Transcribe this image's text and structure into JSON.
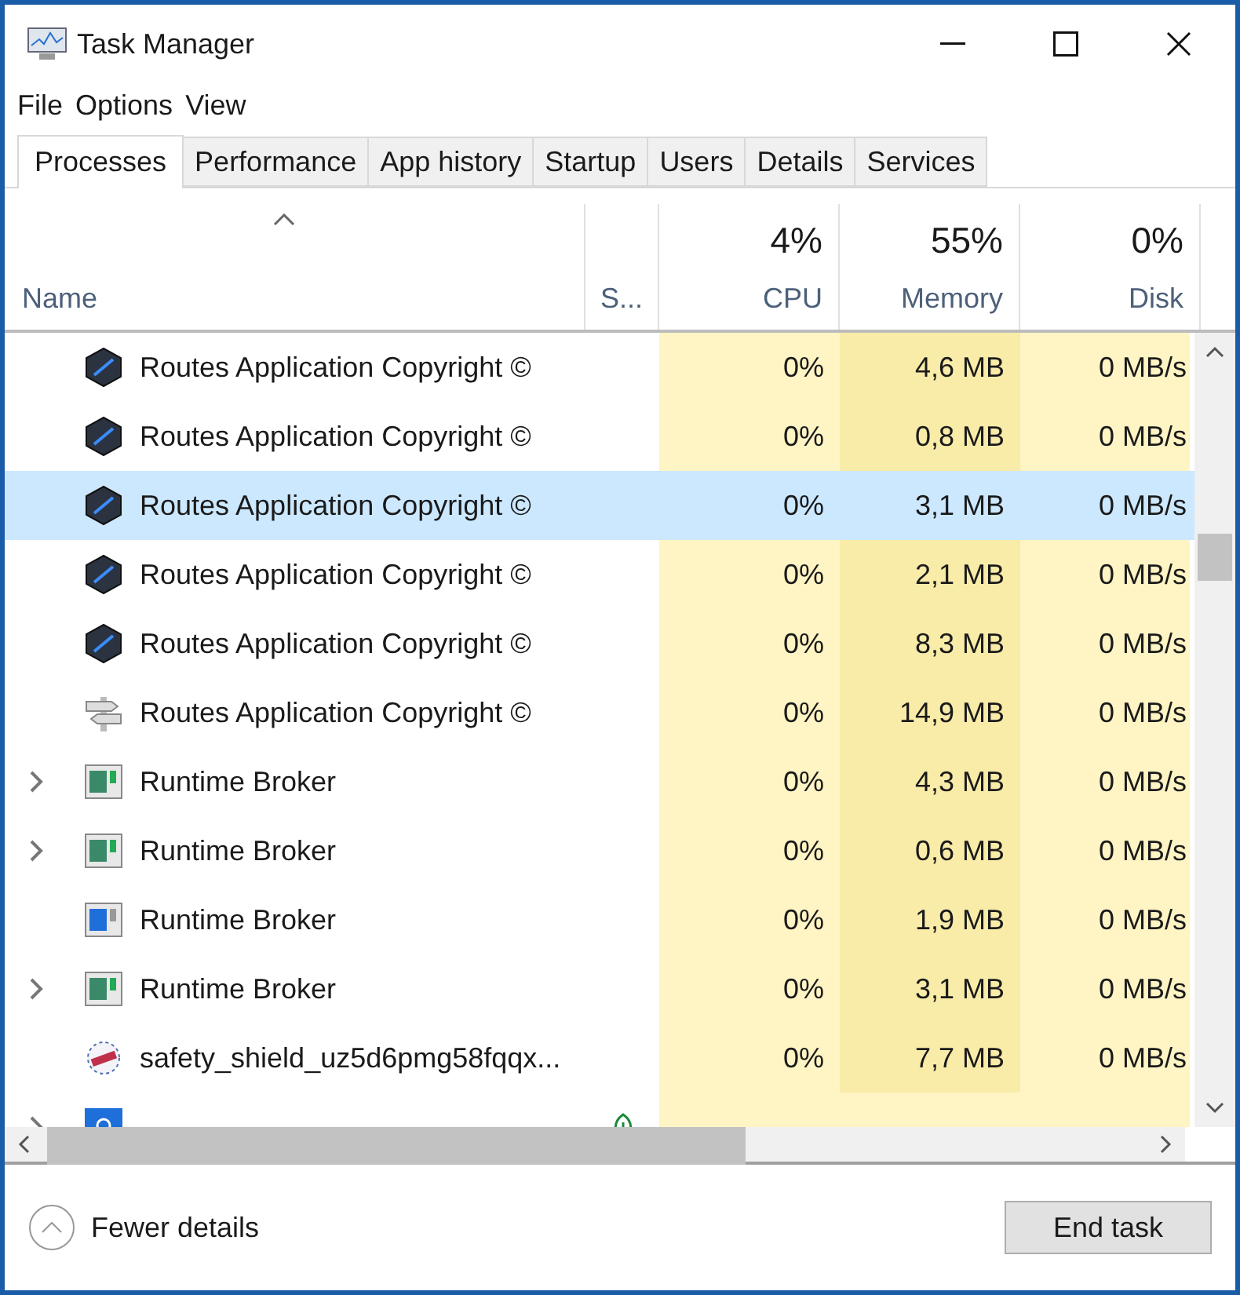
{
  "window": {
    "title": "Task Manager"
  },
  "menu": [
    "File",
    "Options",
    "View"
  ],
  "tabs": [
    {
      "label": "Processes",
      "selected": true
    },
    {
      "label": "Performance",
      "selected": false
    },
    {
      "label": "App history",
      "selected": false
    },
    {
      "label": "Startup",
      "selected": false
    },
    {
      "label": "Users",
      "selected": false
    },
    {
      "label": "Details",
      "selected": false
    },
    {
      "label": "Services",
      "selected": false
    }
  ],
  "table": {
    "columns": [
      {
        "label": "Name"
      },
      {
        "label": "S..."
      },
      {
        "percent": "4%",
        "label": "CPU"
      },
      {
        "percent": "55%",
        "label": "Memory"
      },
      {
        "percent": "0%",
        "label": "Disk"
      }
    ],
    "rows": [
      {
        "kind": "routes",
        "expandable": false,
        "selected": false,
        "suspended": false,
        "name": "Routes Application Copyright ©",
        "cpu": "0%",
        "memory": "4,6 MB",
        "disk": "0 MB/s"
      },
      {
        "kind": "routes",
        "expandable": false,
        "selected": false,
        "suspended": false,
        "name": "Routes Application Copyright ©",
        "cpu": "0%",
        "memory": "0,8 MB",
        "disk": "0 MB/s"
      },
      {
        "kind": "routes",
        "expandable": false,
        "selected": true,
        "suspended": false,
        "name": "Routes Application Copyright ©",
        "cpu": "0%",
        "memory": "3,1 MB",
        "disk": "0 MB/s"
      },
      {
        "kind": "routes",
        "expandable": false,
        "selected": false,
        "suspended": false,
        "name": "Routes Application Copyright ©",
        "cpu": "0%",
        "memory": "2,1 MB",
        "disk": "0 MB/s"
      },
      {
        "kind": "routes",
        "expandable": false,
        "selected": false,
        "suspended": false,
        "name": "Routes Application Copyright ©",
        "cpu": "0%",
        "memory": "8,3 MB",
        "disk": "0 MB/s"
      },
      {
        "kind": "signpost",
        "expandable": false,
        "selected": false,
        "suspended": false,
        "name": "Routes Application Copyright ©",
        "cpu": "0%",
        "memory": "14,9 MB",
        "disk": "0 MB/s"
      },
      {
        "kind": "broker",
        "expandable": true,
        "selected": false,
        "suspended": false,
        "name": "Runtime Broker",
        "cpu": "0%",
        "memory": "4,3 MB",
        "disk": "0 MB/s"
      },
      {
        "kind": "broker",
        "expandable": true,
        "selected": false,
        "suspended": false,
        "name": "Runtime Broker",
        "cpu": "0%",
        "memory": "0,6 MB",
        "disk": "0 MB/s"
      },
      {
        "kind": "broker-blue",
        "expandable": false,
        "selected": false,
        "suspended": false,
        "name": "Runtime Broker",
        "cpu": "0%",
        "memory": "1,9 MB",
        "disk": "0 MB/s"
      },
      {
        "kind": "broker",
        "expandable": true,
        "selected": false,
        "suspended": false,
        "name": "Runtime Broker",
        "cpu": "0%",
        "memory": "3,1 MB",
        "disk": "0 MB/s"
      },
      {
        "kind": "shield",
        "expandable": false,
        "selected": false,
        "suspended": false,
        "name": "safety_shield_uz5d6pmg58fqqx...",
        "cpu": "0%",
        "memory": "7,7 MB",
        "disk": "0 MB/s"
      },
      {
        "kind": "search",
        "expandable": true,
        "selected": false,
        "suspended": true
      }
    ]
  },
  "footer": {
    "toggle": "Fewer details",
    "button": "End task"
  }
}
